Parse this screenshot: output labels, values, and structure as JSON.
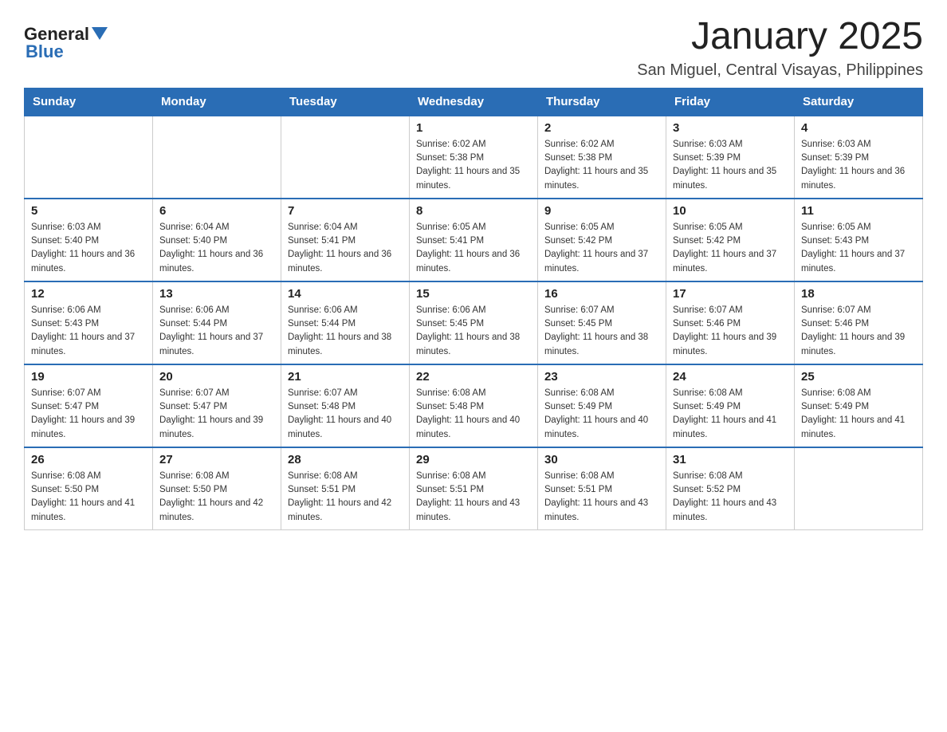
{
  "header": {
    "logo": {
      "general": "General",
      "blue": "Blue"
    },
    "title": "January 2025",
    "location": "San Miguel, Central Visayas, Philippines"
  },
  "days_of_week": [
    "Sunday",
    "Monday",
    "Tuesday",
    "Wednesday",
    "Thursday",
    "Friday",
    "Saturday"
  ],
  "weeks": [
    [
      {
        "day": "",
        "info": ""
      },
      {
        "day": "",
        "info": ""
      },
      {
        "day": "",
        "info": ""
      },
      {
        "day": "1",
        "info": "Sunrise: 6:02 AM\nSunset: 5:38 PM\nDaylight: 11 hours and 35 minutes."
      },
      {
        "day": "2",
        "info": "Sunrise: 6:02 AM\nSunset: 5:38 PM\nDaylight: 11 hours and 35 minutes."
      },
      {
        "day": "3",
        "info": "Sunrise: 6:03 AM\nSunset: 5:39 PM\nDaylight: 11 hours and 35 minutes."
      },
      {
        "day": "4",
        "info": "Sunrise: 6:03 AM\nSunset: 5:39 PM\nDaylight: 11 hours and 36 minutes."
      }
    ],
    [
      {
        "day": "5",
        "info": "Sunrise: 6:03 AM\nSunset: 5:40 PM\nDaylight: 11 hours and 36 minutes."
      },
      {
        "day": "6",
        "info": "Sunrise: 6:04 AM\nSunset: 5:40 PM\nDaylight: 11 hours and 36 minutes."
      },
      {
        "day": "7",
        "info": "Sunrise: 6:04 AM\nSunset: 5:41 PM\nDaylight: 11 hours and 36 minutes."
      },
      {
        "day": "8",
        "info": "Sunrise: 6:05 AM\nSunset: 5:41 PM\nDaylight: 11 hours and 36 minutes."
      },
      {
        "day": "9",
        "info": "Sunrise: 6:05 AM\nSunset: 5:42 PM\nDaylight: 11 hours and 37 minutes."
      },
      {
        "day": "10",
        "info": "Sunrise: 6:05 AM\nSunset: 5:42 PM\nDaylight: 11 hours and 37 minutes."
      },
      {
        "day": "11",
        "info": "Sunrise: 6:05 AM\nSunset: 5:43 PM\nDaylight: 11 hours and 37 minutes."
      }
    ],
    [
      {
        "day": "12",
        "info": "Sunrise: 6:06 AM\nSunset: 5:43 PM\nDaylight: 11 hours and 37 minutes."
      },
      {
        "day": "13",
        "info": "Sunrise: 6:06 AM\nSunset: 5:44 PM\nDaylight: 11 hours and 37 minutes."
      },
      {
        "day": "14",
        "info": "Sunrise: 6:06 AM\nSunset: 5:44 PM\nDaylight: 11 hours and 38 minutes."
      },
      {
        "day": "15",
        "info": "Sunrise: 6:06 AM\nSunset: 5:45 PM\nDaylight: 11 hours and 38 minutes."
      },
      {
        "day": "16",
        "info": "Sunrise: 6:07 AM\nSunset: 5:45 PM\nDaylight: 11 hours and 38 minutes."
      },
      {
        "day": "17",
        "info": "Sunrise: 6:07 AM\nSunset: 5:46 PM\nDaylight: 11 hours and 39 minutes."
      },
      {
        "day": "18",
        "info": "Sunrise: 6:07 AM\nSunset: 5:46 PM\nDaylight: 11 hours and 39 minutes."
      }
    ],
    [
      {
        "day": "19",
        "info": "Sunrise: 6:07 AM\nSunset: 5:47 PM\nDaylight: 11 hours and 39 minutes."
      },
      {
        "day": "20",
        "info": "Sunrise: 6:07 AM\nSunset: 5:47 PM\nDaylight: 11 hours and 39 minutes."
      },
      {
        "day": "21",
        "info": "Sunrise: 6:07 AM\nSunset: 5:48 PM\nDaylight: 11 hours and 40 minutes."
      },
      {
        "day": "22",
        "info": "Sunrise: 6:08 AM\nSunset: 5:48 PM\nDaylight: 11 hours and 40 minutes."
      },
      {
        "day": "23",
        "info": "Sunrise: 6:08 AM\nSunset: 5:49 PM\nDaylight: 11 hours and 40 minutes."
      },
      {
        "day": "24",
        "info": "Sunrise: 6:08 AM\nSunset: 5:49 PM\nDaylight: 11 hours and 41 minutes."
      },
      {
        "day": "25",
        "info": "Sunrise: 6:08 AM\nSunset: 5:49 PM\nDaylight: 11 hours and 41 minutes."
      }
    ],
    [
      {
        "day": "26",
        "info": "Sunrise: 6:08 AM\nSunset: 5:50 PM\nDaylight: 11 hours and 41 minutes."
      },
      {
        "day": "27",
        "info": "Sunrise: 6:08 AM\nSunset: 5:50 PM\nDaylight: 11 hours and 42 minutes."
      },
      {
        "day": "28",
        "info": "Sunrise: 6:08 AM\nSunset: 5:51 PM\nDaylight: 11 hours and 42 minutes."
      },
      {
        "day": "29",
        "info": "Sunrise: 6:08 AM\nSunset: 5:51 PM\nDaylight: 11 hours and 43 minutes."
      },
      {
        "day": "30",
        "info": "Sunrise: 6:08 AM\nSunset: 5:51 PM\nDaylight: 11 hours and 43 minutes."
      },
      {
        "day": "31",
        "info": "Sunrise: 6:08 AM\nSunset: 5:52 PM\nDaylight: 11 hours and 43 minutes."
      },
      {
        "day": "",
        "info": ""
      }
    ]
  ]
}
